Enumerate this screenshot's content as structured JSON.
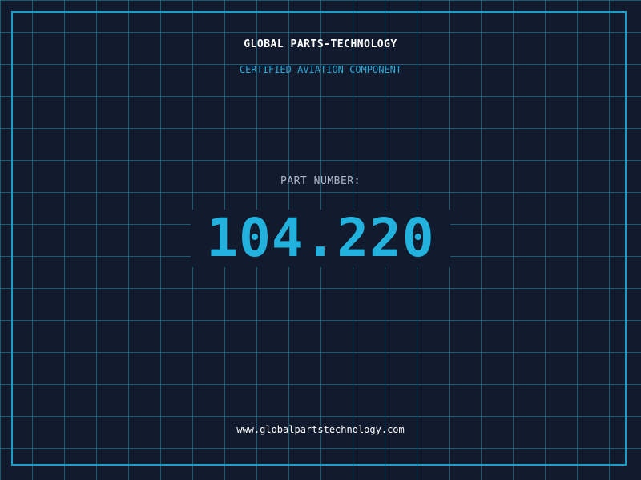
{
  "header": {
    "company": "GLOBAL PARTS-TECHNOLOGY",
    "subtitle": "CERTIFIED AVIATION COMPONENT"
  },
  "main": {
    "part_label": "PART NUMBER:",
    "part_number": "104.220"
  },
  "footer": {
    "website": "www.globalpartstechnology.com"
  },
  "colors": {
    "background": "#121a2e",
    "grid": "#288ca5",
    "frame": "#1b9fc9",
    "accent": "#22b2dd",
    "label": "#aeb8c8",
    "text": "#ffffff"
  }
}
